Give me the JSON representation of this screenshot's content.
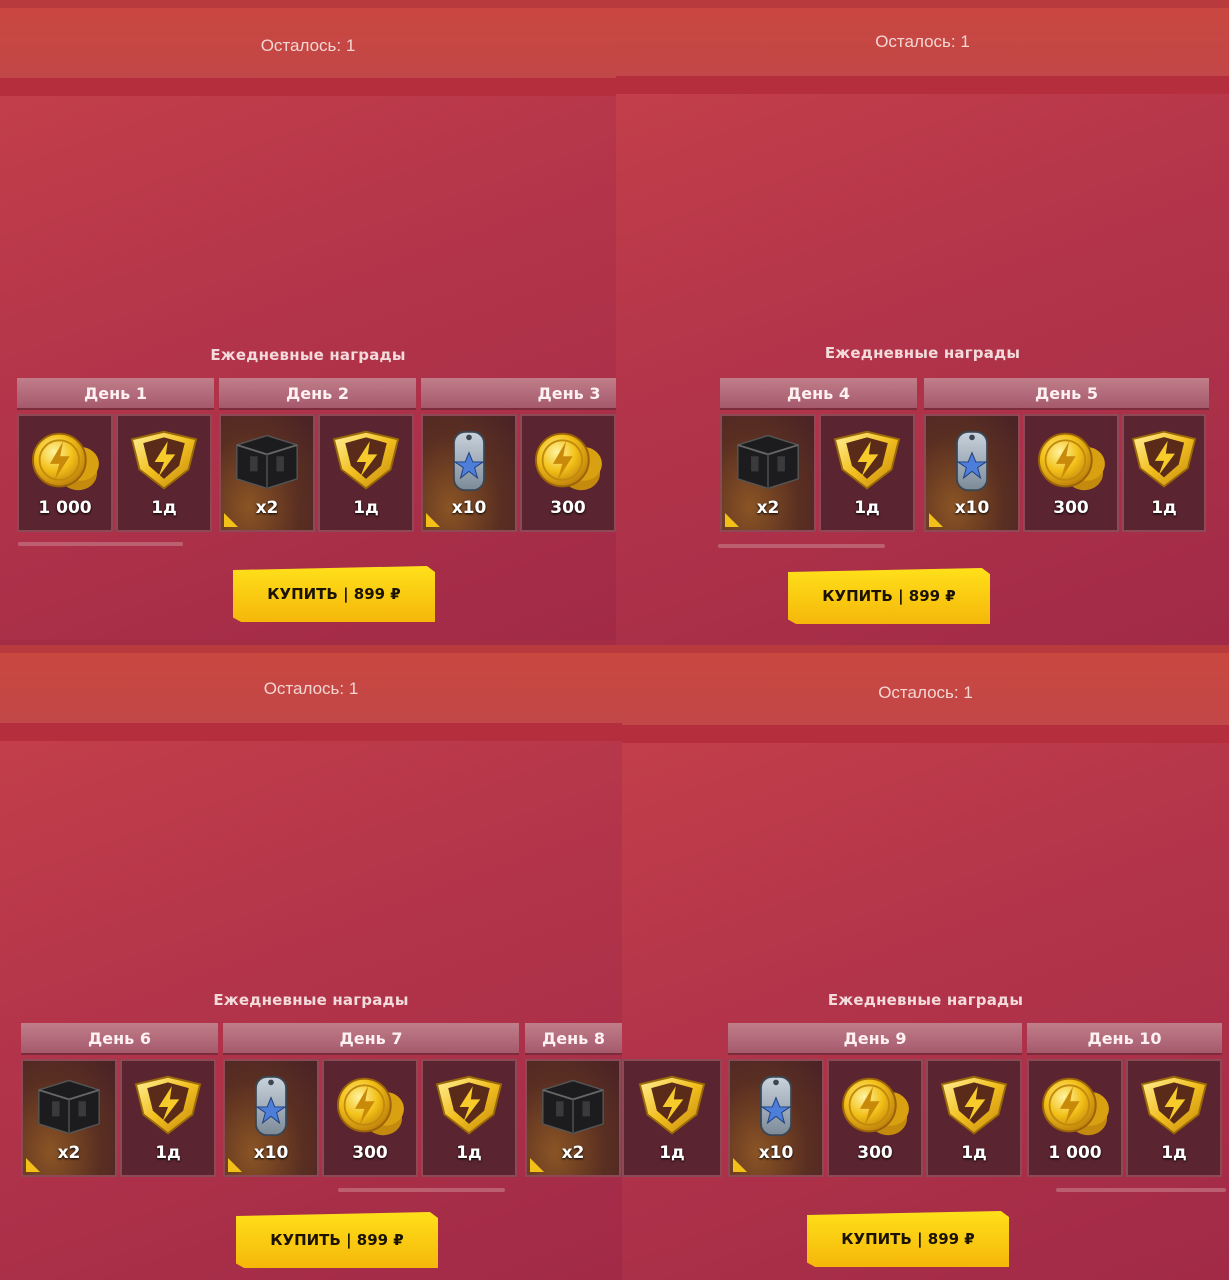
{
  "remaining_label": "Осталось: 1",
  "remaining_label_alt": "Осталось: 1",
  "section_title": "Ежедневные награды",
  "buy_label": "КУПИТЬ | 899 ₽",
  "colors": {
    "gold": "#f2c018",
    "panel": "#b4354a",
    "button": "#ffd514"
  },
  "days": {
    "d1": "День 1",
    "d2": "День 2",
    "d3": "День 3",
    "d4": "День 4",
    "d5": "День 5",
    "d6": "День 6",
    "d7": "День 7",
    "d8": "День 8",
    "d9": "День 9",
    "d10": "День 10"
  },
  "rewards": {
    "coins_1000": "1 000",
    "coins_300": "300",
    "premium_1d": "1д",
    "chest_x2": "x2",
    "token_x10": "x10"
  },
  "icons": [
    "coin-stack-icon",
    "premium-shield-icon",
    "black-chest-icon",
    "dog-tag-icon"
  ]
}
